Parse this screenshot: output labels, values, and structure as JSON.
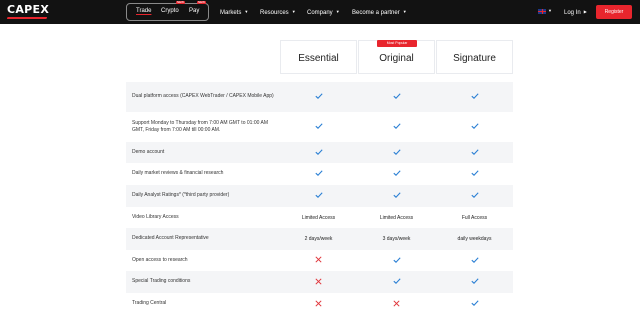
{
  "nav": {
    "logo": "CAPEX",
    "group": {
      "trade": "Trade",
      "crypto": "Crypto",
      "pay": "Pay",
      "new_tag": "NEW"
    },
    "menu": {
      "markets": "Markets",
      "resources": "Resources",
      "company": "Company",
      "partner": "Become a partner"
    },
    "login": "Log In",
    "register": "Register",
    "colors": {
      "accent": "#e8252d",
      "bar": "#121212"
    }
  },
  "plans": [
    {
      "name": "Essential"
    },
    {
      "name": "Original",
      "badge": "Most Popular"
    },
    {
      "name": "Signature"
    }
  ],
  "rows": [
    {
      "feature": "Dual platform access (CAPEX WebTrader / CAPEX Mobile App)",
      "values": [
        "check",
        "check",
        "check"
      ]
    },
    {
      "feature": "Support Monday to Thursday from 7:00 AM GMT to 01:00 AM GMT, Friday from 7:00 AM till 00:00 AM.",
      "values": [
        "check",
        "check",
        "check"
      ]
    },
    {
      "feature": "Demo account",
      "values": [
        "check",
        "check",
        "check"
      ]
    },
    {
      "feature": "Daily market reviews & financial research",
      "values": [
        "check",
        "check",
        "check"
      ]
    },
    {
      "feature": "Daily Analyst Ratings* (*third party provider)",
      "values": [
        "check",
        "check",
        "check"
      ]
    },
    {
      "feature": "Video Library Access",
      "values": [
        "Limited Access",
        "Limited Access",
        "Full Access"
      ]
    },
    {
      "feature": "Dedicated Account Representative",
      "values": [
        "2 days/week",
        "3 days/week",
        "daily weekdays"
      ]
    },
    {
      "feature": "Open access to research",
      "values": [
        "cross",
        "check",
        "check"
      ]
    },
    {
      "feature": "Special Trading conditions",
      "values": [
        "cross",
        "check",
        "check"
      ]
    },
    {
      "feature": "Trading Central",
      "values": [
        "cross",
        "cross",
        "check"
      ]
    }
  ]
}
